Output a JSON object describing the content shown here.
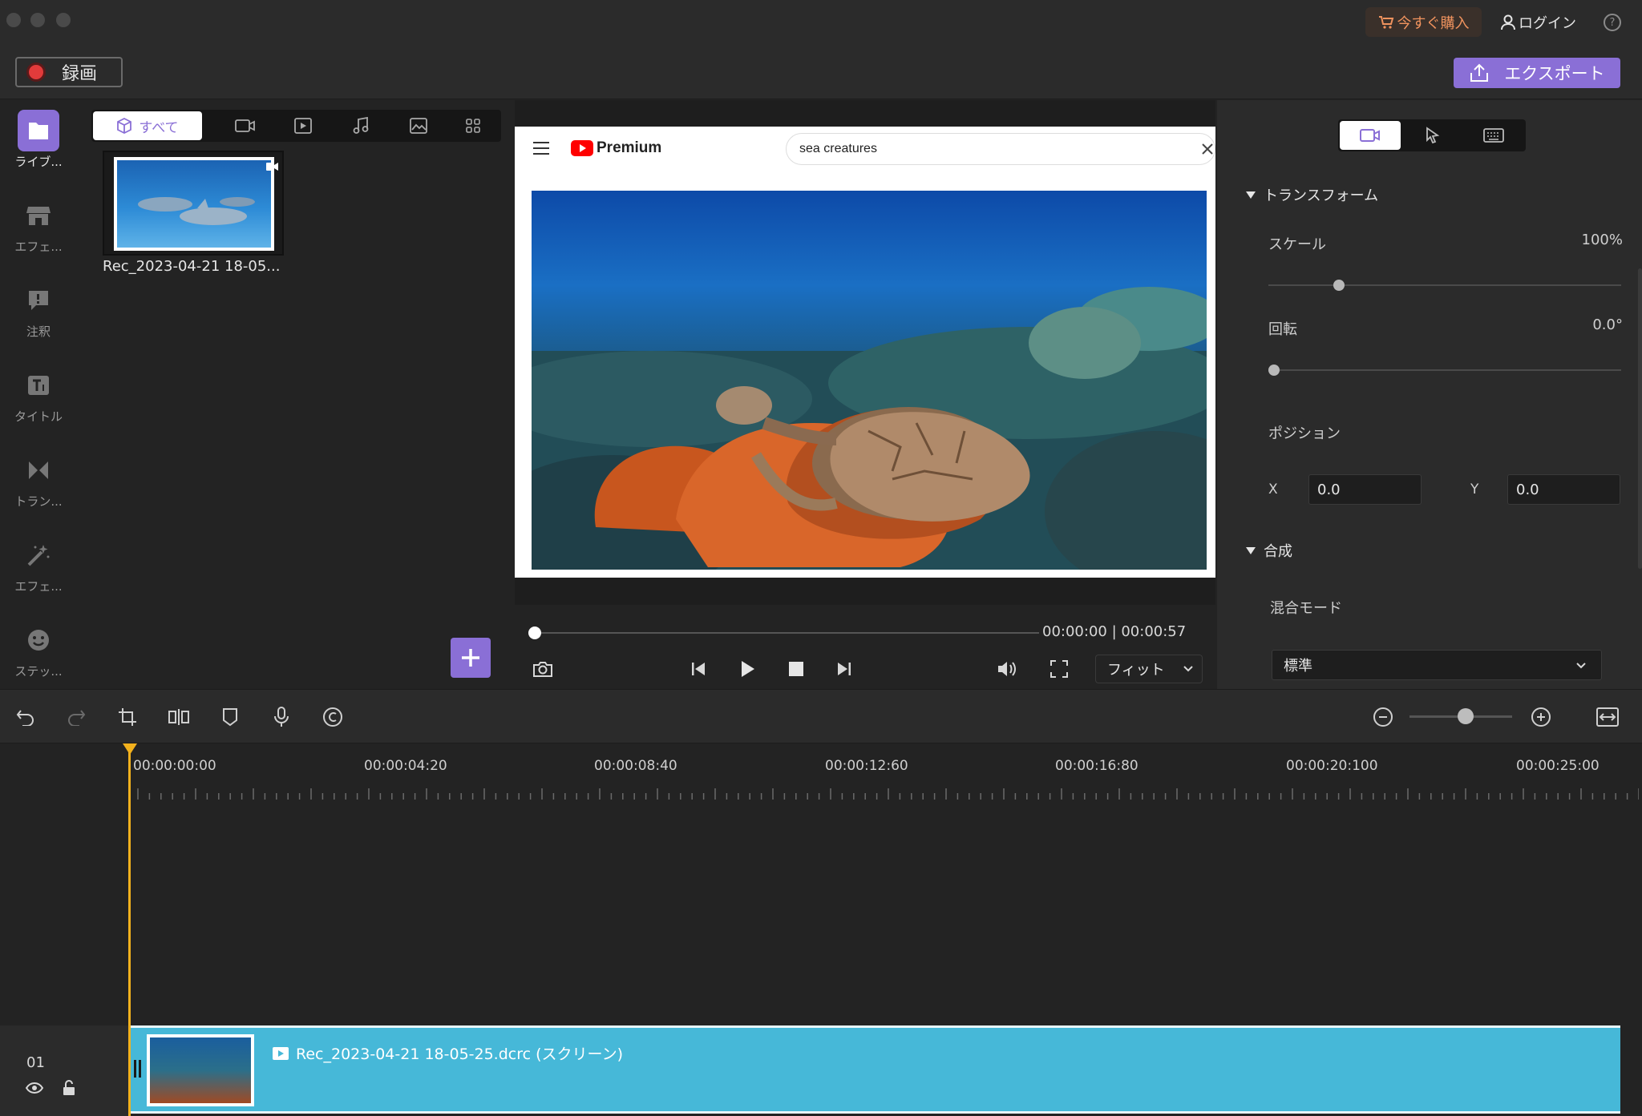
{
  "titlebar": {
    "buy_label": "今すぐ購入",
    "login_label": "ログイン",
    "help_glyph": "?"
  },
  "toolbar": {
    "record_label": "録画",
    "export_label": "エクスポート"
  },
  "sidebar": {
    "items": [
      {
        "label": "ライブ...",
        "icon": "library-icon"
      },
      {
        "label": "エフェ...",
        "icon": "store-icon"
      },
      {
        "label": "注釈",
        "icon": "annotation-icon"
      },
      {
        "label": "タイトル",
        "icon": "title-icon"
      },
      {
        "label": "トラン...",
        "icon": "transition-icon"
      },
      {
        "label": "エフェ...",
        "icon": "effects-wand-icon"
      },
      {
        "label": "ステッ...",
        "icon": "sticker-icon"
      }
    ]
  },
  "library": {
    "tab_all_label": "すべて",
    "media": [
      {
        "name": "Rec_2023-04-21 18-05..."
      }
    ]
  },
  "preview": {
    "yt_brand": "Premium",
    "search_text": "sea creatures",
    "timecode": "00:00:00 | 00:00:57",
    "fit_label": "フィット",
    "progress": 0
  },
  "properties": {
    "transform_label": "トランスフォーム",
    "scale_label": "スケール",
    "scale_value": "100%",
    "rotation_label": "回転",
    "rotation_value": "0.0°",
    "position_label": "ポジション",
    "x_label": "X",
    "x_value": "0.0",
    "y_label": "Y",
    "y_value": "0.0",
    "composite_label": "合成",
    "blend_label": "混合モード",
    "blend_value": "標準"
  },
  "timeline": {
    "ruler": [
      "00:00:00:00",
      "00:00:04:20",
      "00:00:08:40",
      "00:00:12:60",
      "00:00:16:80",
      "00:00:20:100",
      "00:00:25:00"
    ],
    "track_number": "01",
    "clip_name": "Rec_2023-04-21 18-05-25.dcrc (スクリーン)"
  },
  "colors": {
    "accent": "#8a6fd6",
    "playhead": "#f2b11d",
    "clip": "#46b8d8",
    "record": "#e23b3b",
    "buy": "#f0935e"
  }
}
